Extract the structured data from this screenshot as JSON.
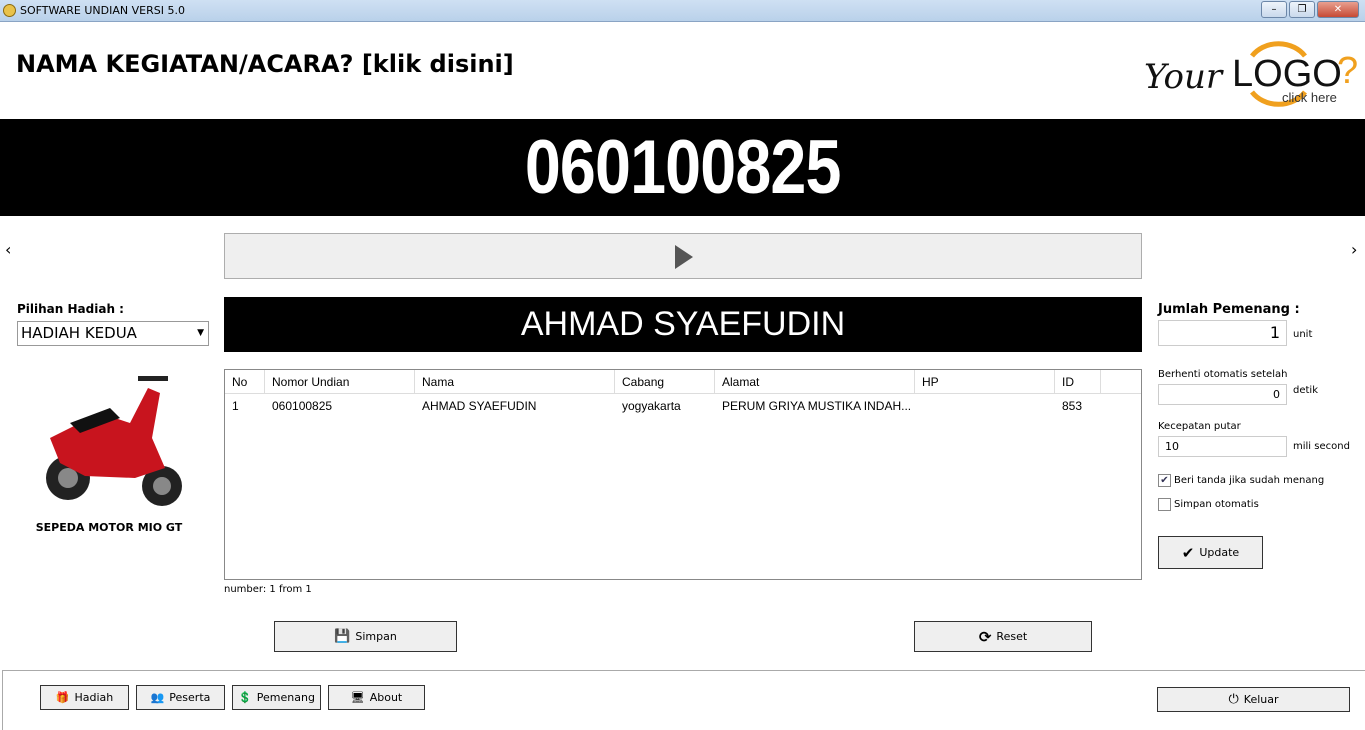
{
  "window": {
    "title": "SOFTWARE UNDIAN VERSI 5.0"
  },
  "header": {
    "event_title": "NAMA KEGIATAN/ACARA? [klik disini]",
    "logo": {
      "text_your": "Your",
      "text_logo": "LOGO",
      "text_q": "?",
      "subtitle": "click here",
      "accent": "#f0a01e"
    }
  },
  "draw": {
    "number": "060100825",
    "winner_name": "AHMAD SYAEFUDIN",
    "prev": "‹",
    "next": "›"
  },
  "prize": {
    "label": "Pilihan Hadiah :",
    "selected": "HADIAH KEDUA",
    "item_name": "SEPEDA MOTOR MIO GT"
  },
  "table": {
    "columns": [
      "No",
      "Nomor Undian",
      "Nama",
      "Cabang",
      "Alamat",
      "HP",
      "ID"
    ],
    "rows": [
      [
        "1",
        "060100825",
        "AHMAD SYAEFUDIN",
        "yogyakarta",
        "PERUM GRIYA MUSTIKA INDAH...",
        "",
        "853"
      ]
    ],
    "status": "number: 1 from 1"
  },
  "settings": {
    "winners_label": "Jumlah Pemenang :",
    "winners_value": "1",
    "winners_unit": "unit",
    "auto_stop_label": "Berhenti otomatis setelah",
    "auto_stop_value": "0",
    "auto_stop_unit": "detik",
    "speed_label": "Kecepatan putar",
    "speed_value": "10",
    "speed_unit": "mili second",
    "mark_winner_label": "Beri tanda jika sudah menang",
    "mark_winner_checked": true,
    "autosave_label": "Simpan otomatis",
    "autosave_checked": false,
    "update_label": "Update"
  },
  "actions": {
    "save": "Simpan",
    "reset": "Reset"
  },
  "footer": {
    "hadiah": "Hadiah",
    "peserta": "Peserta",
    "pemenang": "Pemenang",
    "about": "About",
    "exit": "Keluar"
  }
}
